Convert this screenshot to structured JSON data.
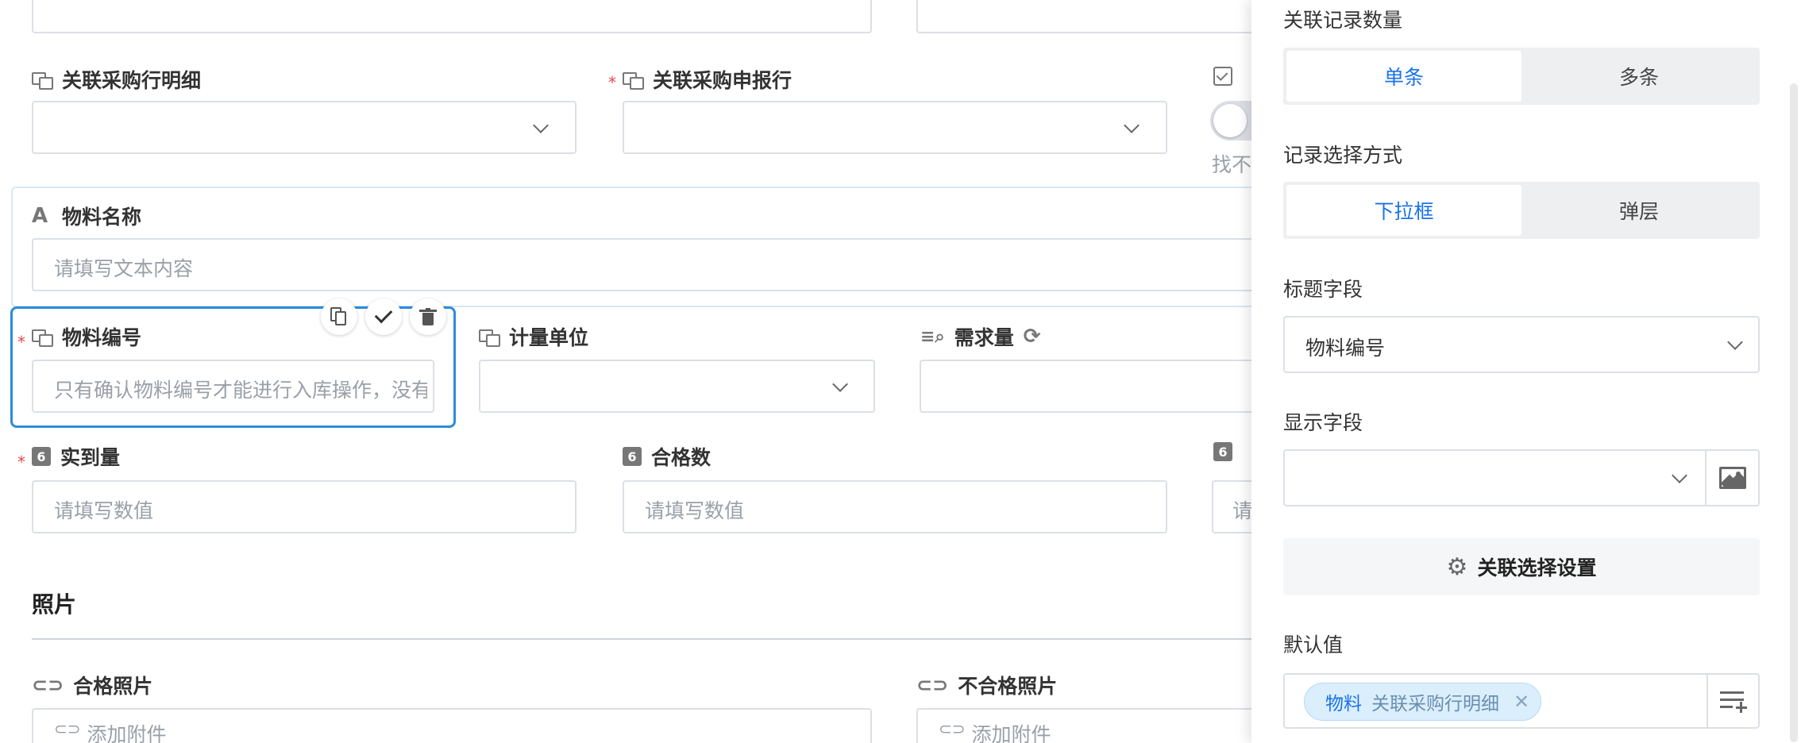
{
  "form": {
    "field_purchase_detail": {
      "label": "关联采购行明细"
    },
    "field_purchase_apply": {
      "label": "关联采购申报行"
    },
    "field_partial_label": {
      "label": "找不"
    },
    "field_material_name": {
      "label": "物料名称",
      "placeholder": "请填写文本内容"
    },
    "field_material_code": {
      "label": "物料编号",
      "placeholder": "只有确认物料编号才能进行入库操作，没有"
    },
    "field_unit": {
      "label": "计量单位"
    },
    "field_demand": {
      "label": "需求量"
    },
    "field_actual": {
      "label": "实到量",
      "placeholder": "请填写数值"
    },
    "field_qualified": {
      "label": "合格数",
      "placeholder": "请填写数值"
    },
    "field_partial_third": {
      "placeholder": "请"
    },
    "number_icon_text": "6",
    "section_photo": "照片",
    "field_qualified_photo": {
      "label": "合格照片",
      "placeholder": "添加附件"
    },
    "field_unqualified_photo": {
      "label": "不合格照片",
      "placeholder": "添加附件"
    }
  },
  "panel": {
    "record_count": {
      "title": "关联记录数量",
      "options": [
        "单条",
        "多条"
      ],
      "selected": "单条"
    },
    "select_mode": {
      "title": "记录选择方式",
      "options": [
        "下拉框",
        "弹层"
      ],
      "selected": "下拉框"
    },
    "title_field": {
      "title": "标题字段",
      "value": "物料编号"
    },
    "display_field": {
      "title": "显示字段",
      "value": ""
    },
    "relation_settings_label": "关联选择设置",
    "default_value": {
      "title": "默认值",
      "tag_main": "物料",
      "tag_sub": "关联采购行明细"
    }
  },
  "colors": {
    "accent": "#1a73e8",
    "required": "#e5484d",
    "selected_border": "#2d8cdb"
  }
}
